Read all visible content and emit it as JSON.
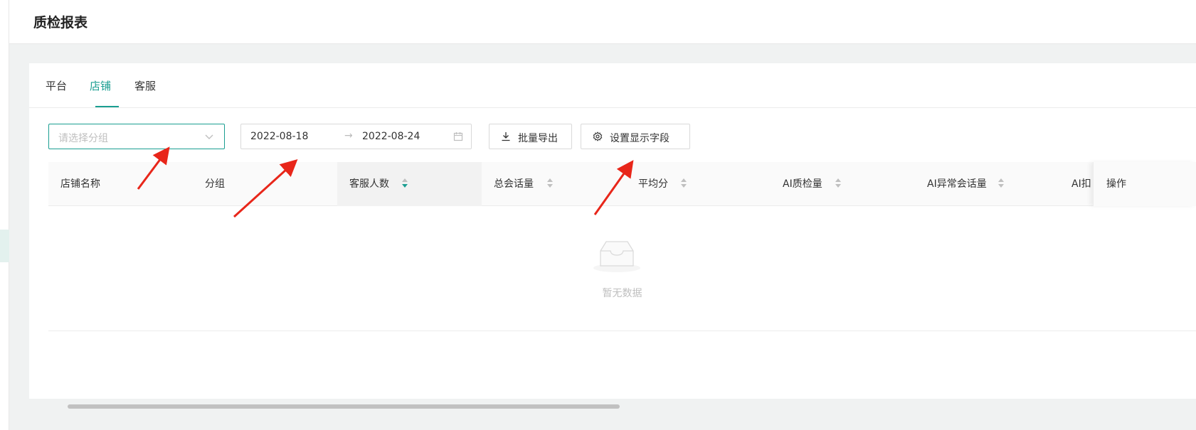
{
  "page": {
    "title": "质检报表"
  },
  "tabs": [
    {
      "label": "平台",
      "active": false
    },
    {
      "label": "店铺",
      "active": true
    },
    {
      "label": "客服",
      "active": false
    }
  ],
  "filters": {
    "group_select": {
      "placeholder": "请选择分组"
    },
    "date_range": {
      "start": "2022-08-18",
      "separator": "→",
      "end": "2022-08-24"
    }
  },
  "toolbar": {
    "export_label": "批量导出",
    "fields_label": "设置显示字段"
  },
  "table": {
    "columns": [
      {
        "label": "店铺名称",
        "sortable": false
      },
      {
        "label": "分组",
        "sortable": false
      },
      {
        "label": "客服人数",
        "sortable": true,
        "sort": "descend"
      },
      {
        "label": "总会话量",
        "sortable": true
      },
      {
        "label": "平均分",
        "sortable": true
      },
      {
        "label": "AI质检量",
        "sortable": true
      },
      {
        "label": "AI异常会话量",
        "sortable": true
      },
      {
        "label": "AI扣",
        "sortable": false
      }
    ],
    "fixed_column": "操作",
    "empty_text": "暂无数据",
    "rows": []
  },
  "colors": {
    "accent": "#1a9e91",
    "annotation_arrow": "#e8261a"
  },
  "icons": {
    "select": "chevron-down-icon",
    "date": "calendar-icon",
    "export": "download-icon",
    "fields": "gear-icon",
    "empty": "inbox-icon"
  }
}
